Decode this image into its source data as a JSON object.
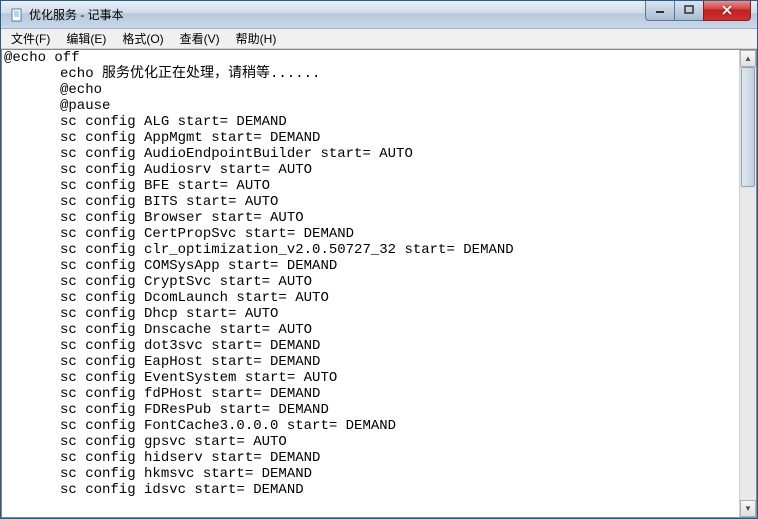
{
  "window": {
    "title": "优化服务 - 记事本"
  },
  "menu": {
    "file": "文件(F)",
    "edit": "编辑(E)",
    "format": "格式(O)",
    "view": "查看(V)",
    "help": "帮助(H)"
  },
  "content": {
    "line0": "@echo off",
    "lines": [
      "echo 服务优化正在处理，请稍等......",
      "@echo",
      "@pause",
      "sc config ALG start= DEMAND",
      "sc config AppMgmt start= DEMAND",
      "sc config AudioEndpointBuilder start= AUTO",
      "sc config Audiosrv start= AUTO",
      "sc config BFE start= AUTO",
      "sc config BITS start= AUTO",
      "sc config Browser start= AUTO",
      "sc config CertPropSvc start= DEMAND",
      "sc config clr_optimization_v2.0.50727_32 start= DEMAND",
      "sc config COMSysApp start= DEMAND",
      "sc config CryptSvc start= AUTO",
      "sc config DcomLaunch start= AUTO",
      "sc config Dhcp start= AUTO",
      "sc config Dnscache start= AUTO",
      "sc config dot3svc start= DEMAND",
      "sc config EapHost start= DEMAND",
      "sc config EventSystem start= AUTO",
      "sc config fdPHost start= DEMAND",
      "sc config FDResPub start= DEMAND",
      "sc config FontCache3.0.0.0 start= DEMAND",
      "sc config gpsvc start= AUTO",
      "sc config hidserv start= DEMAND",
      "sc config hkmsvc start= DEMAND",
      "sc config idsvc start= DEMAND"
    ]
  }
}
